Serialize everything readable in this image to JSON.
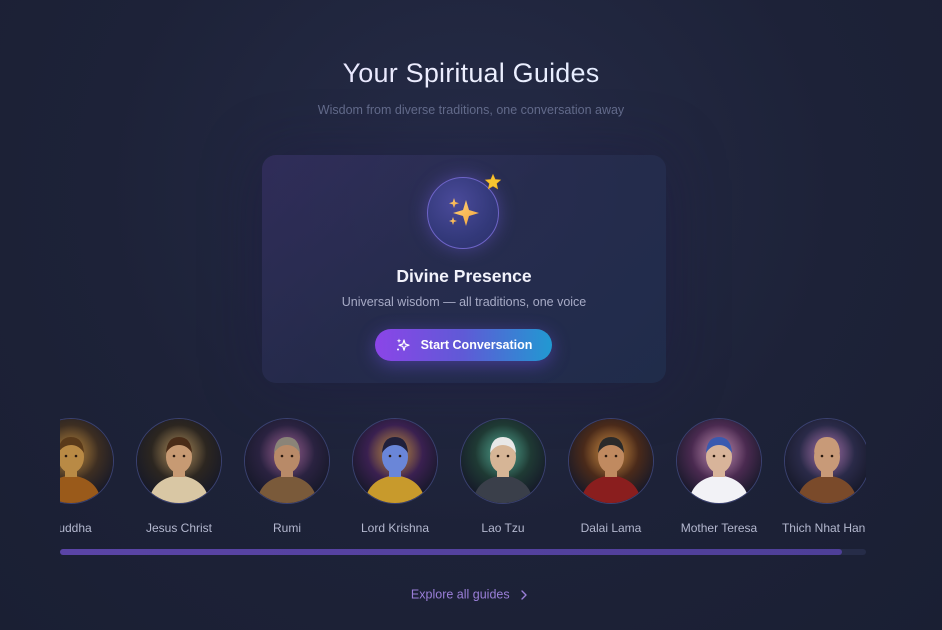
{
  "header": {
    "title": "Your Spiritual Guides",
    "subtitle": "Wisdom from diverse traditions, one conversation away"
  },
  "featured": {
    "name": "Divine Presence",
    "description": "Universal wisdom — all traditions, one voice",
    "button_label": "Start Conversation",
    "icon": "sparkles-icon",
    "badge_icon": "star-icon"
  },
  "guides": [
    {
      "name": "Buddha",
      "bg": "#3d2e22",
      "skin": "#b98a45",
      "robe": "#9a5a1a",
      "hair": "#5a3a1a",
      "glow": "#d89a3c"
    },
    {
      "name": "Jesus Christ",
      "bg": "#2c2620",
      "skin": "#c79a73",
      "robe": "#d9c7a4",
      "hair": "#4a2c18",
      "glow": "#c8a060"
    },
    {
      "name": "Rumi",
      "bg": "#2a2240",
      "skin": "#b88a68",
      "robe": "#7a5a3a",
      "hair": "#8a8478",
      "glow": "#b06aa0"
    },
    {
      "name": "Lord Krishna",
      "bg": "#3a2050",
      "skin": "#6a86d8",
      "robe": "#c89a2c",
      "hair": "#20203a",
      "glow": "#e0a040"
    },
    {
      "name": "Lao Tzu",
      "bg": "#1f3a34",
      "skin": "#d6b596",
      "robe": "#3a3f4a",
      "hair": "#e8e8e8",
      "glow": "#5ac0a0"
    },
    {
      "name": "Dalai Lama",
      "bg": "#4a2a1a",
      "skin": "#c08a60",
      "robe": "#8a1e1e",
      "hair": "#2a2a2a",
      "glow": "#f0a040"
    },
    {
      "name": "Mother Teresa",
      "bg": "#4a2a50",
      "skin": "#d8b49a",
      "robe": "#f2f2f6",
      "hair": "#3a5ab0",
      "glow": "#e0a0c8"
    },
    {
      "name": "Thich Nhat Hanh",
      "bg": "#2a2a48",
      "skin": "#c89a78",
      "robe": "#7a4a2a",
      "hair": "#c89a78",
      "glow": "#c080c0"
    }
  ],
  "scroll": {
    "position_fraction": 0.97
  },
  "footer": {
    "explore_label": "Explore all guides",
    "explore_icon": "chevron-right-icon"
  }
}
